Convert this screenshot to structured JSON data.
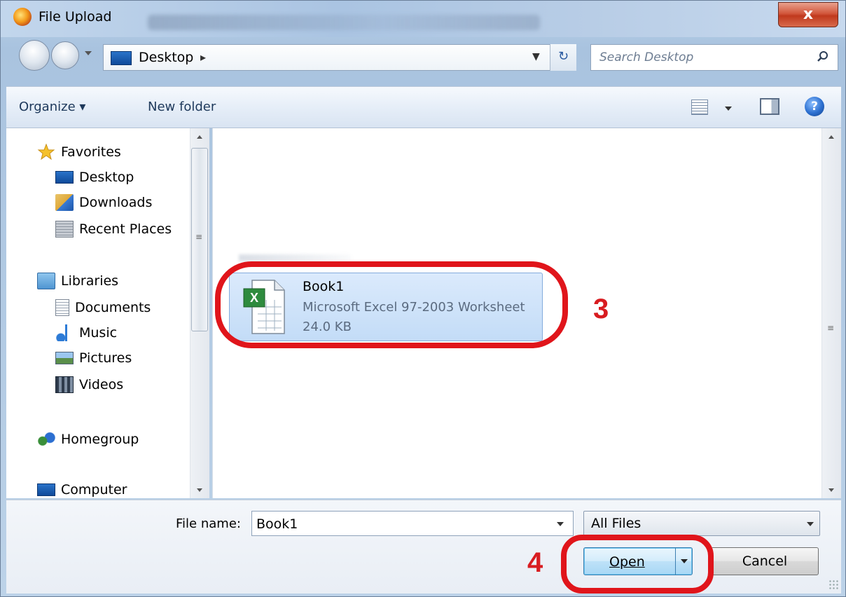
{
  "window": {
    "title": "File Upload",
    "close_label": "x"
  },
  "address_bar": {
    "location": "Desktop",
    "separator": "▸",
    "refresh_icon": "refresh-icon"
  },
  "search": {
    "placeholder": "Search Desktop"
  },
  "toolbar": {
    "organize_label": "Organize ▾",
    "new_folder_label": "New folder",
    "help_label": "?"
  },
  "navigation": {
    "favorites_header": "Favorites",
    "favorites": [
      {
        "label": "Desktop",
        "icon": "desktop-icon"
      },
      {
        "label": "Downloads",
        "icon": "downloads-icon"
      },
      {
        "label": "Recent Places",
        "icon": "recent-places-icon"
      }
    ],
    "libraries_header": "Libraries",
    "libraries": [
      {
        "label": "Documents",
        "icon": "documents-icon"
      },
      {
        "label": "Music",
        "icon": "music-icon"
      },
      {
        "label": "Pictures",
        "icon": "pictures-icon"
      },
      {
        "label": "Videos",
        "icon": "videos-icon"
      }
    ],
    "homegroup": "Homegroup",
    "computer": "Computer"
  },
  "files": [
    {
      "name": "Book1",
      "type": "Microsoft Excel 97-2003 Worksheet",
      "size": "24.0 KB",
      "icon": "excel-file-icon",
      "selected": true
    }
  ],
  "annotations": {
    "step_file": "3",
    "step_open": "4",
    "ring_color": "#e0151b"
  },
  "bottom": {
    "file_name_label": "File name:",
    "file_name_value": "Book1",
    "file_type_value": "All Files",
    "open_label": "Open",
    "cancel_label": "Cancel"
  },
  "colors": {
    "selection": "#c3dcf7",
    "toolbar_text": "#1e395b",
    "close_button": "#c0391d"
  }
}
